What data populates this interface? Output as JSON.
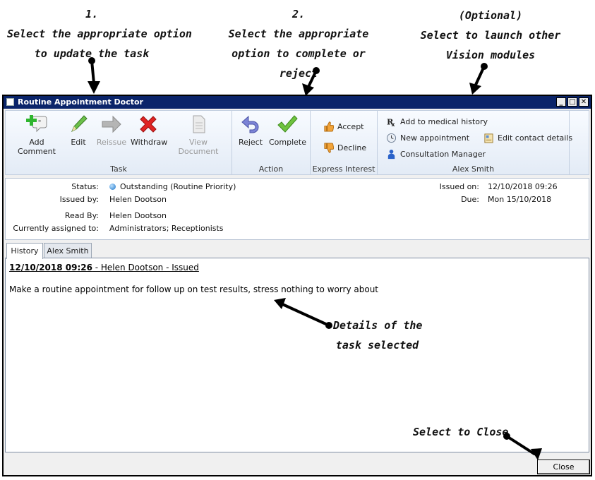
{
  "annotations": {
    "step1": {
      "num": "1.",
      "line1": "Select the appropriate option",
      "line2": "to update the task"
    },
    "step2": {
      "num": "2.",
      "line1": "Select the appropriate",
      "line2": "option to complete or",
      "line3": "reject"
    },
    "optional": {
      "line1": "(Optional)",
      "line2": "Select to launch other",
      "line3": "Vision modules"
    },
    "details": {
      "line1": "Details of the",
      "line2": "task selected"
    },
    "close": "Select to Close"
  },
  "window": {
    "title": "Routine Appointment Doctor",
    "controls": {
      "minimize": "_",
      "maximize": "□",
      "close": "✕"
    }
  },
  "ribbon": {
    "task_group": {
      "label": "Task",
      "buttons": [
        {
          "label": "Add Comment",
          "icon": "add-comment-icon",
          "enabled": true
        },
        {
          "label": "Edit",
          "icon": "pencil-icon",
          "enabled": true
        },
        {
          "label": "Reissue",
          "icon": "arrow-right-icon",
          "enabled": false
        },
        {
          "label": "Withdraw",
          "icon": "red-x-icon",
          "enabled": true
        },
        {
          "label": "View Document",
          "icon": "document-icon",
          "enabled": false
        }
      ]
    },
    "action_group": {
      "label": "Action",
      "buttons": [
        {
          "label": "Reject",
          "icon": "undo-arrow-icon"
        },
        {
          "label": "Complete",
          "icon": "check-icon"
        }
      ]
    },
    "interest_group": {
      "label": "Express Interest",
      "buttons": [
        {
          "label": "Accept",
          "icon": "thumbs-up-icon"
        },
        {
          "label": "Decline",
          "icon": "thumbs-down-icon"
        }
      ]
    },
    "patient_group": {
      "label": "Alex Smith",
      "buttons": [
        {
          "label": "Add to medical history",
          "icon": "rx-icon"
        },
        {
          "label": "New appointment",
          "icon": "clock-icon"
        },
        {
          "label": "Consultation Manager",
          "icon": "consultation-icon"
        },
        {
          "label": "Edit contact details",
          "icon": "contact-card-icon"
        }
      ]
    }
  },
  "details": {
    "status_label": "Status:",
    "status_value": "Outstanding (Routine Priority)",
    "issued_by_label": "Issued by:",
    "issued_by_value": "Helen Dootson",
    "read_by_label": "Read By:",
    "read_by_value": "Helen Dootson",
    "assigned_label": "Currently assigned to:",
    "assigned_value": "Administrators; Receptionists",
    "issued_on_label": "Issued on:",
    "issued_on_value": "12/10/2018 09:26",
    "due_label": "Due:",
    "due_value": "Mon 15/10/2018"
  },
  "tabs": [
    {
      "label": "History",
      "active": true
    },
    {
      "label": "Alex Smith",
      "active": false
    }
  ],
  "history": {
    "entry_timestamp": "12/10/2018 09:26",
    "entry_rest": " - Helen Dootson - Issued",
    "entry_text": "Make a routine appointment for follow up on test results, stress nothing to worry about"
  },
  "footer": {
    "close_label": "Close"
  }
}
